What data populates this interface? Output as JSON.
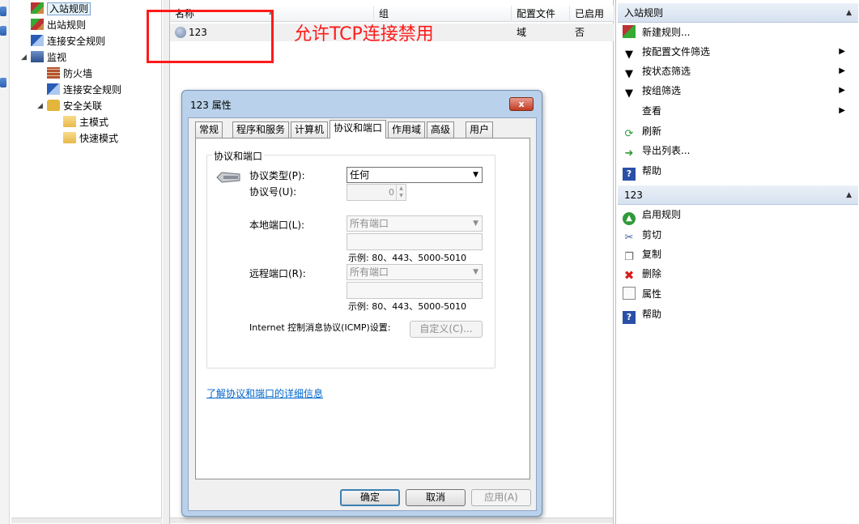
{
  "tree": {
    "items": [
      {
        "label": "入站规则",
        "icon": "inbound-rules-icon"
      },
      {
        "label": "出站规则",
        "icon": "outbound-rules-icon"
      },
      {
        "label": "连接安全规则",
        "icon": "connection-security-icon"
      },
      {
        "label": "监视",
        "icon": "monitor-icon"
      },
      {
        "label": "防火墙",
        "icon": "firewall-icon"
      },
      {
        "label": "连接安全规则",
        "icon": "connection-security-icon"
      },
      {
        "label": "安全关联",
        "icon": "lock-icon"
      },
      {
        "label": "主模式",
        "icon": "folder-icon"
      },
      {
        "label": "快速模式",
        "icon": "folder-icon"
      }
    ]
  },
  "rules_list": {
    "columns": [
      "名称",
      "组",
      "配置文件",
      "已启用"
    ],
    "rows": [
      {
        "name": "123",
        "group": "",
        "profile": "域",
        "enabled": "否"
      }
    ]
  },
  "annotation": {
    "text": "允许TCP连接禁用"
  },
  "actions": {
    "section1": {
      "title": "入站规则",
      "items": [
        {
          "label": "新建规则...",
          "icon": "new-rule-icon"
        },
        {
          "label": "按配置文件筛选",
          "icon": "filter-icon"
        },
        {
          "label": "按状态筛选",
          "icon": "filter-icon"
        },
        {
          "label": "按组筛选",
          "icon": "filter-icon"
        },
        {
          "label": "查看",
          "icon": "view-icon"
        },
        {
          "label": "刷新",
          "icon": "refresh-icon"
        },
        {
          "label": "导出列表...",
          "icon": "export-icon"
        },
        {
          "label": "帮助",
          "icon": "help-icon"
        }
      ]
    },
    "section2": {
      "title": "123",
      "items": [
        {
          "label": "启用规则",
          "icon": "enable-icon"
        },
        {
          "label": "剪切",
          "icon": "cut-icon"
        },
        {
          "label": "复制",
          "icon": "copy-icon"
        },
        {
          "label": "删除",
          "icon": "delete-icon"
        },
        {
          "label": "属性",
          "icon": "properties-icon"
        },
        {
          "label": "帮助",
          "icon": "help-icon"
        }
      ]
    }
  },
  "dialog": {
    "title": "123 属性",
    "close_glyph": "x",
    "tabs": [
      "常规",
      "程序和服务",
      "计算机",
      "协议和端口",
      "作用域",
      "高级",
      "用户"
    ],
    "active_tab": "协议和端口",
    "group_title": "协议和端口",
    "protocol_type_label": "协议类型(P):",
    "protocol_type_value": "任何",
    "protocol_number_label": "协议号(U):",
    "protocol_number_value": "0",
    "local_port_label": "本地端口(L):",
    "local_port_value": "所有端口",
    "local_port_hint": "示例: 80、443、5000-5010",
    "remote_port_label": "远程端口(R):",
    "remote_port_value": "所有端口",
    "remote_port_hint": "示例: 80、443、5000-5010",
    "icmp_label": "Internet 控制消息协议(ICMP)设置:",
    "customize_label": "自定义(C)...",
    "learn_more_link": "了解协议和端口的详细信息",
    "ok_label": "确定",
    "cancel_label": "取消",
    "apply_label": "应用(A)"
  }
}
